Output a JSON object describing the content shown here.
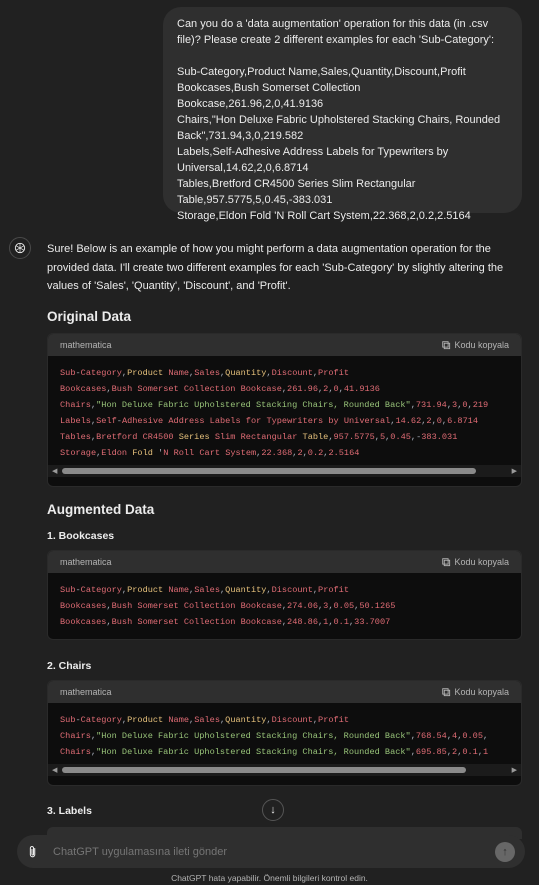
{
  "user_message": "Can you do a 'data augmentation' operation for this data (in .csv file)? Please create 2 different examples for each 'Sub-Category':\n\nSub-Category,Product Name,Sales,Quantity,Discount,Profit\nBookcases,Bush Somerset Collection Bookcase,261.96,2,0,41.9136\nChairs,\"Hon Deluxe Fabric Upholstered Stacking Chairs, Rounded Back\",731.94,3,0,219.582\nLabels,Self-Adhesive Address Labels for Typewriters by Universal,14.62,2,0,6.8714\nTables,Bretford CR4500 Series Slim Rectangular Table,957.5775,5,0.45,-383.031\nStorage,Eldon Fold 'N Roll Cart System,22.368,2,0.2,2.5164",
  "assistant_intro": "Sure! Below is an example of how you might perform a data augmentation operation for the provided data. I'll create two different examples for each 'Sub-Category' by slightly altering the values of 'Sales', 'Quantity', 'Discount', and 'Profit'.",
  "sections": {
    "original": "Original Data",
    "augmented": "Augmented Data",
    "bookcases": "1. Bookcases",
    "chairs": "2. Chairs",
    "labels": "3. Labels"
  },
  "code_lang": "mathematica",
  "copy_label": "Kodu kopyala",
  "code_original": [
    "Sub-Category,Product Name,Sales,Quantity,Discount,Profit",
    "Bookcases,Bush Somerset Collection Bookcase,261.96,2,0,41.9136",
    "Chairs,\"Hon Deluxe Fabric Upholstered Stacking Chairs, Rounded Back\",731.94,3,0,219",
    "Labels,Self-Adhesive Address Labels for Typewriters by Universal,14.62,2,0,6.8714",
    "Tables,Bretford CR4500 Series Slim Rectangular Table,957.5775,5,0.45,-383.031",
    "Storage,Eldon Fold 'N Roll Cart System,22.368,2,0.2,2.5164"
  ],
  "code_bookcases": [
    "Sub-Category,Product Name,Sales,Quantity,Discount,Profit",
    "Bookcases,Bush Somerset Collection Bookcase,274.06,3,0.05,50.1265",
    "Bookcases,Bush Somerset Collection Bookcase,248.86,1,0.1,33.7007"
  ],
  "code_chairs": [
    "Sub-Category,Product Name,Sales,Quantity,Discount,Profit",
    "Chairs,\"Hon Deluxe Fabric Upholstered Stacking Chairs, Rounded Back\",768.54,4,0.05,",
    "Chairs,\"Hon Deluxe Fabric Upholstered Stacking Chairs, Rounded Back\",695.85,2,0.1,1"
  ],
  "composer_placeholder": "ChatGPT uygulamasına ileti gönder",
  "footer": "ChatGPT hata yapabilir. Önemli bilgileri kontrol edin.",
  "colors": {
    "bg": "#212121",
    "bubble": "#2f2f2f",
    "code_bg": "#0d0d0d",
    "pink": "#e06c75",
    "green": "#98c379",
    "yellow": "#e5c07b"
  }
}
